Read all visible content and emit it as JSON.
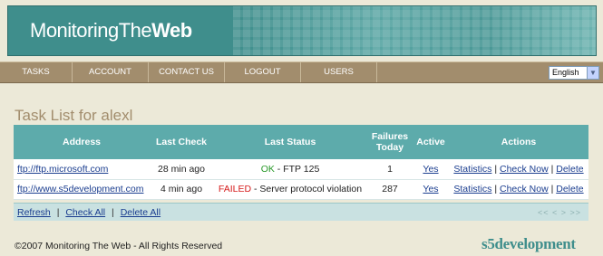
{
  "header": {
    "logo_part_1": "Monitoring",
    "logo_part_2": "The",
    "logo_part_3": "Web"
  },
  "nav": {
    "items": [
      {
        "label": "TASKS"
      },
      {
        "label": "ACCOUNT"
      },
      {
        "label": "CONTACT US"
      },
      {
        "label": "LOGOUT"
      },
      {
        "label": "USERS"
      }
    ],
    "language": "English"
  },
  "page": {
    "title": "Task List for alexl"
  },
  "table": {
    "columns": {
      "address": "Address",
      "last_check": "Last Check",
      "last_status": "Last Status",
      "failures_today": "Failures Today",
      "active": "Active",
      "actions": "Actions"
    },
    "rows": [
      {
        "address": "ftp://ftp.microsoft.com",
        "last_check": "28 min ago",
        "status_flag": "OK",
        "status_detail": "- FTP 125",
        "failures": "1",
        "active": "Yes",
        "action_statistics": "Statistics",
        "action_check": "Check Now",
        "action_delete": "Delete"
      },
      {
        "address": "ftp://www.s5development.com",
        "last_check": "4 min ago",
        "status_flag": "FAILED",
        "status_detail": "- Server protocol violation",
        "failures": "287",
        "active": "Yes",
        "action_statistics": "Statistics",
        "action_check": "Check Now",
        "action_delete": "Delete"
      }
    ]
  },
  "footer_links": {
    "refresh": "Refresh",
    "check_all": "Check All",
    "delete_all": "Delete All",
    "separator": "|",
    "pager": "<< < > >>"
  },
  "footer": {
    "copyright": "©2007 Monitoring The Web - All Rights Reserved",
    "brand": "s5development"
  },
  "colors": {
    "header_teal": "#3f8e8c",
    "nav_brown": "#a28d6d",
    "table_header": "#5dabab",
    "ok_green": "#2a9a2a",
    "failed_red": "#d61c1c",
    "link_blue": "#1a3d8f"
  }
}
